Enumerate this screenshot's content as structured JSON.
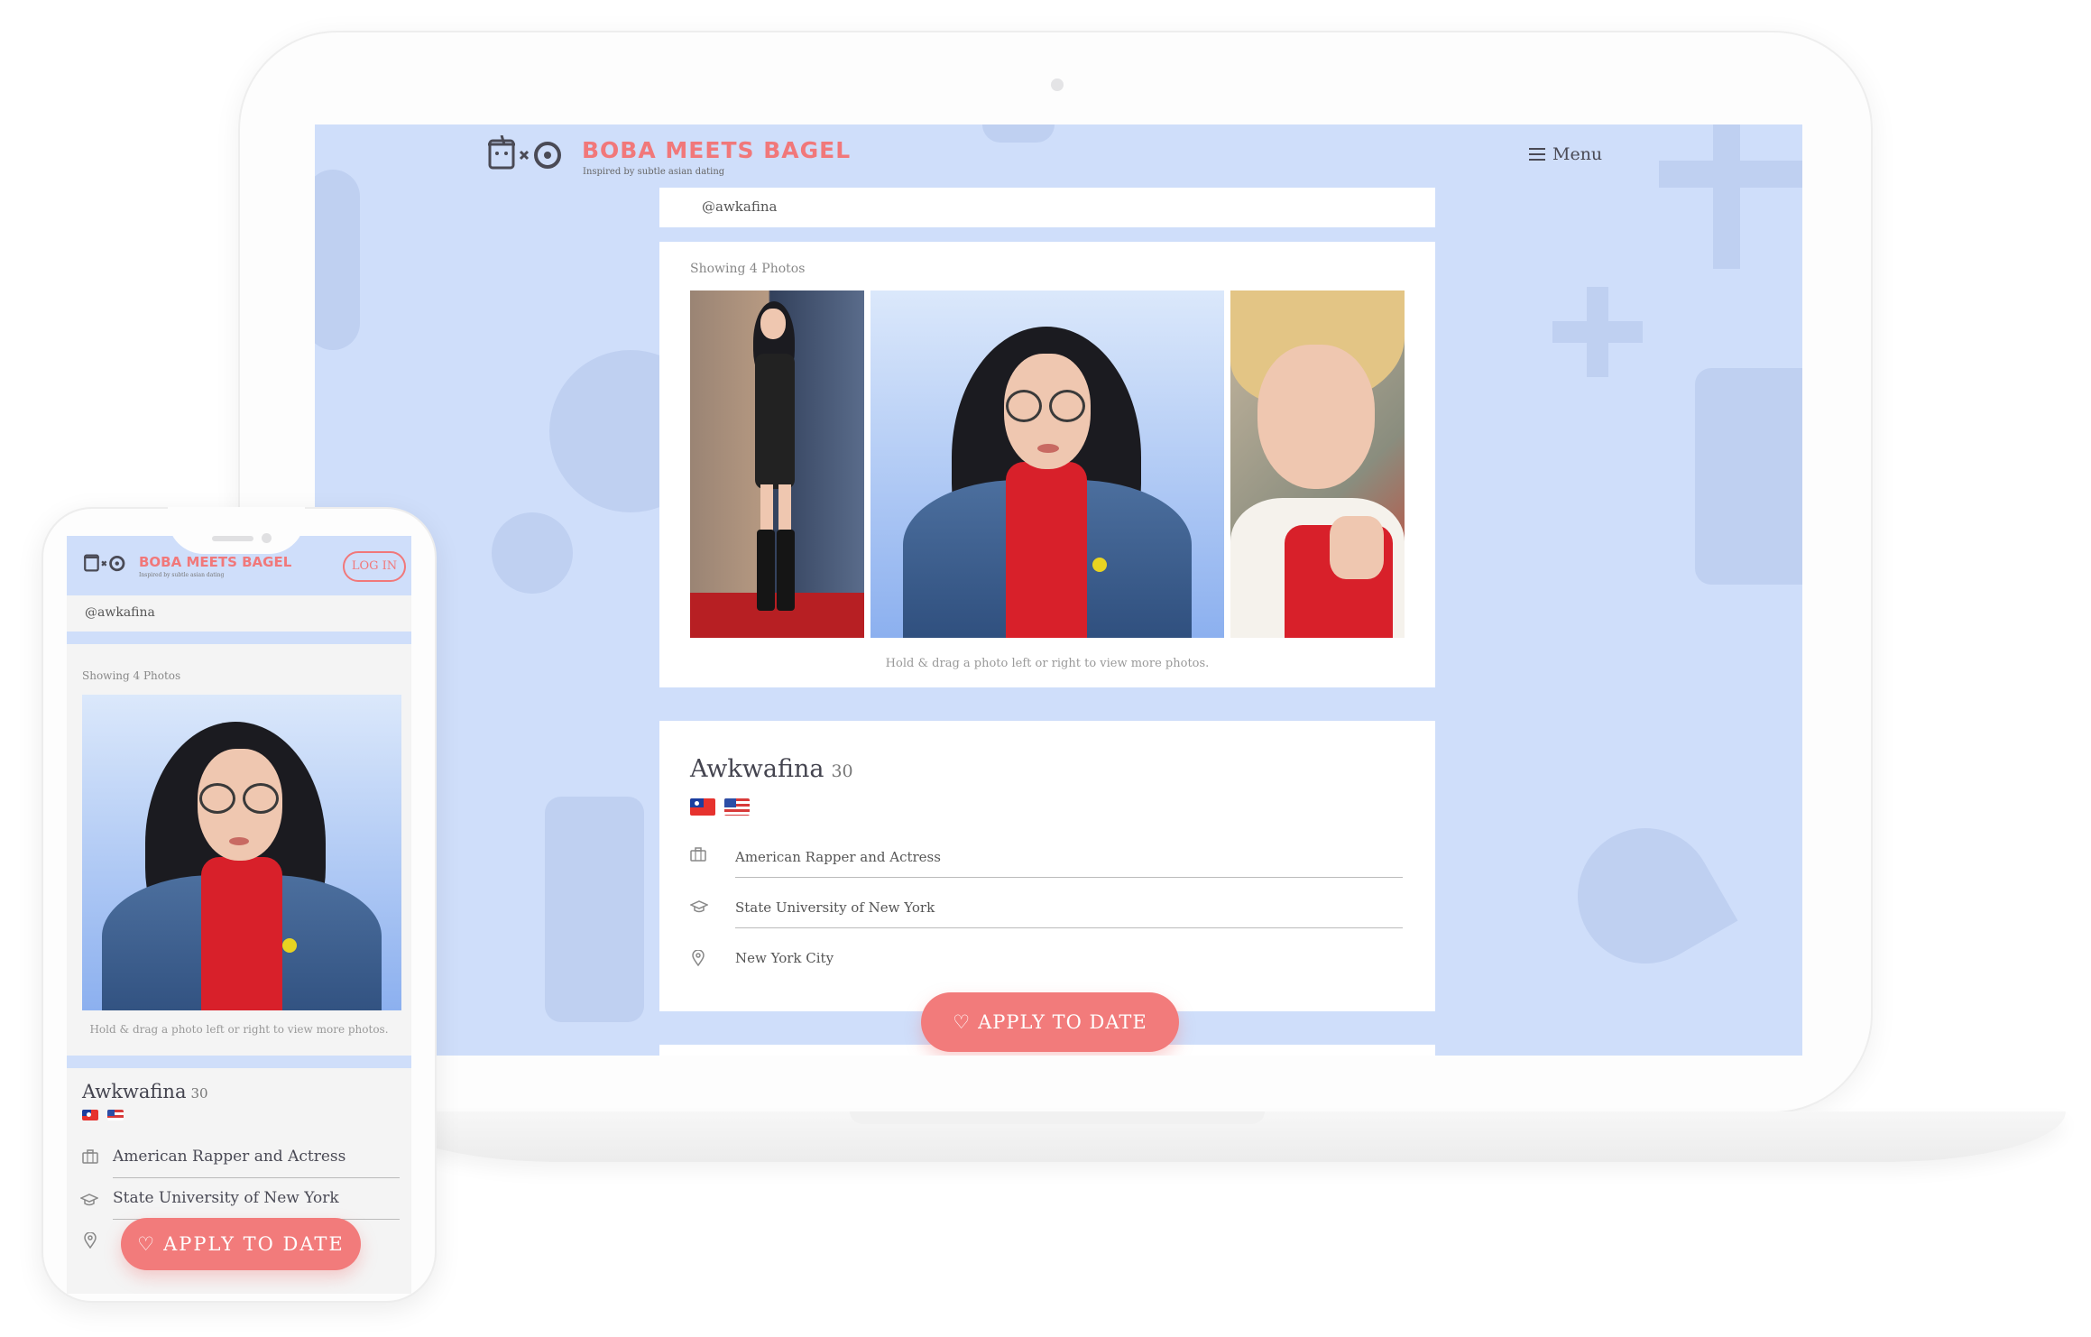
{
  "brand": {
    "name": "BOBA MEETS BAGEL",
    "tagline": "Inspired by subtle asian dating",
    "accent_color": "#f1787a",
    "background_color": "#cfdefa"
  },
  "desktop": {
    "menu_label": "Menu",
    "username": "@awkafina",
    "photos": {
      "count_label": "Showing 4 Photos",
      "hint": "Hold & drag a photo left or right to view more photos."
    },
    "profile": {
      "name": "Awkwafina",
      "age": "30",
      "flags": [
        "taiwan-flag",
        "usa-flag"
      ],
      "details": [
        {
          "icon": "briefcase-icon",
          "text": "American Rapper and Actress"
        },
        {
          "icon": "graduation-cap-icon",
          "text": "State University of New York"
        },
        {
          "icon": "location-pin-icon",
          "text": "New York City"
        }
      ]
    },
    "apply_label": "APPLY TO DATE"
  },
  "mobile": {
    "login_label": "LOG IN",
    "username": "@awkafina",
    "photos": {
      "count_label": "Showing 4 Photos",
      "hint": "Hold & drag a photo left or right to view more photos."
    },
    "profile": {
      "name": "Awkwafina",
      "age": "30",
      "details": [
        {
          "icon": "briefcase-icon",
          "text": "American Rapper and Actress"
        },
        {
          "icon": "graduation-cap-icon",
          "text": "State University of New York"
        },
        {
          "icon": "location-pin-icon",
          "text": ""
        }
      ]
    },
    "apply_label": "APPLY TO DATE"
  }
}
